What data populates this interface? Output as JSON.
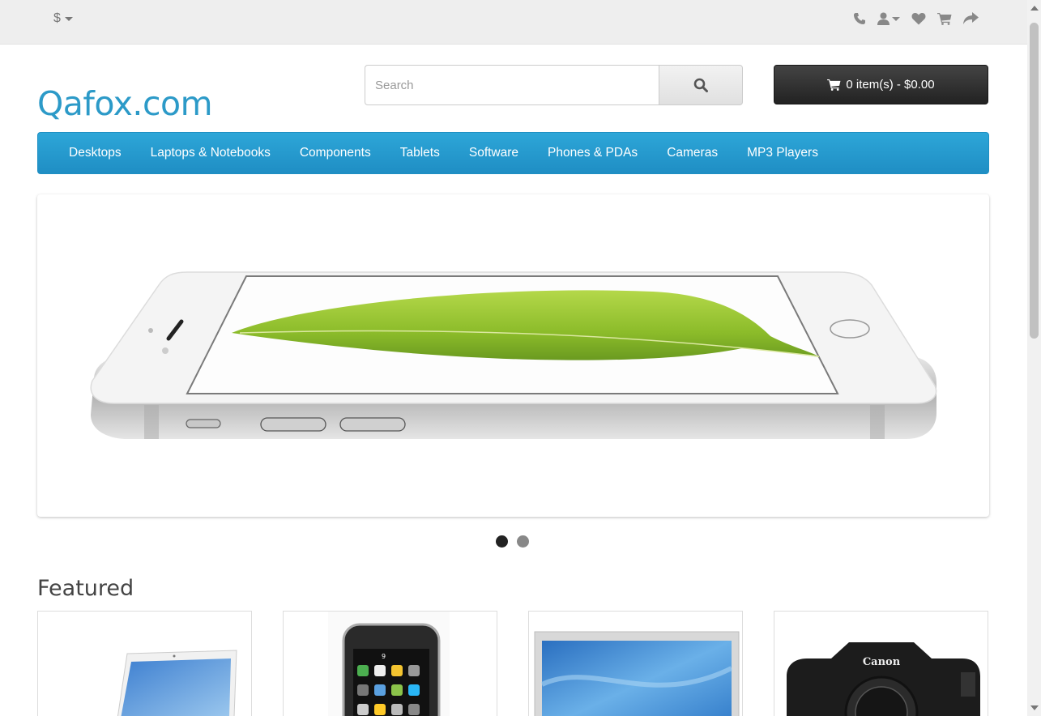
{
  "topbar": {
    "currency_symbol": "$",
    "icons": [
      "phone-icon",
      "user-icon",
      "heart-icon",
      "cart-icon",
      "share-icon"
    ]
  },
  "header": {
    "logo": "Qafox.com",
    "search_placeholder": "Search",
    "cart_label": "0 item(s) - $0.00"
  },
  "menu": {
    "items": [
      "Desktops",
      "Laptops & Notebooks",
      "Components",
      "Tablets",
      "Software",
      "Phones & PDAs",
      "Cameras",
      "MP3 Players"
    ]
  },
  "slideshow": {
    "active_slide": 1,
    "slide_count": 2
  },
  "featured": {
    "title": "Featured",
    "products": [
      "laptop",
      "phone",
      "monitor",
      "camera"
    ],
    "camera_brand": "Canon"
  },
  "colors": {
    "brand": "#2c9ac8",
    "menu": "#229ac8",
    "cart_button": "#303030"
  }
}
